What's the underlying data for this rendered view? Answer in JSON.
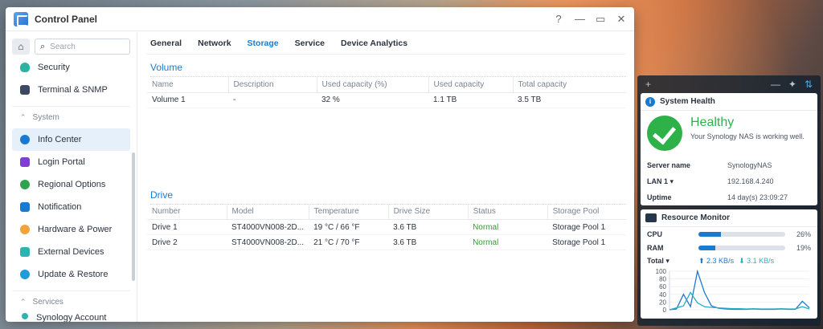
{
  "window": {
    "title": "Control Panel",
    "controls": [
      "?",
      "—",
      "▭",
      "✕"
    ]
  },
  "sidebar": {
    "search_placeholder": "Search",
    "items_top": [
      {
        "label": "Security",
        "color": "#2bb3a1"
      },
      {
        "label": "Terminal & SNMP",
        "color": "#3b4a5e"
      }
    ],
    "section_system": "System",
    "items_system": [
      {
        "label": "Info Center",
        "color": "#1a7ad0",
        "active": true
      },
      {
        "label": "Login Portal",
        "color": "#7e3fd0"
      },
      {
        "label": "Regional Options",
        "color": "#2fa34f"
      },
      {
        "label": "Notification",
        "color": "#1a7ad0"
      },
      {
        "label": "Hardware & Power",
        "color": "#f2a33a"
      },
      {
        "label": "External Devices",
        "color": "#2fb3b0"
      },
      {
        "label": "Update & Restore",
        "color": "#1e9bd8"
      }
    ],
    "section_services": "Services",
    "cutoff_item": "Synology Account"
  },
  "tabs": [
    "General",
    "Network",
    "Storage",
    "Service",
    "Device Analytics"
  ],
  "active_tab": "Storage",
  "volume": {
    "title": "Volume",
    "headers": [
      "Name",
      "Description",
      "Used capacity (%)",
      "Used capacity",
      "Total capacity"
    ],
    "rows": [
      [
        "Volume 1",
        "-",
        "32 %",
        "1.1 TB",
        "3.5 TB"
      ]
    ]
  },
  "drive": {
    "title": "Drive",
    "headers": [
      "Number",
      "Model",
      "Temperature",
      "Drive Size",
      "Status",
      "Storage Pool"
    ],
    "rows": [
      [
        "Drive 1",
        "ST4000VN008-2D...",
        "19 °C / 66 °F",
        "3.6 TB",
        "Normal",
        "Storage Pool 1"
      ],
      [
        "Drive 2",
        "ST4000VN008-2D...",
        "21 °C / 70 °F",
        "3.6 TB",
        "Normal",
        "Storage Pool 1"
      ]
    ]
  },
  "system_health": {
    "title": "System Health",
    "status": "Healthy",
    "message": "Your Synology NAS is working well.",
    "fields": [
      {
        "k": "Server name",
        "v": "SynologyNAS"
      },
      {
        "k": "LAN 1 ▾",
        "v": "192.168.4.240"
      },
      {
        "k": "Uptime",
        "v": "14 day(s) 23:09:27"
      }
    ]
  },
  "resource_monitor": {
    "title": "Resource Monitor",
    "cpu": {
      "label": "CPU",
      "value": 26,
      "text": "26%"
    },
    "ram": {
      "label": "RAM",
      "value": 19,
      "text": "19%"
    },
    "total_label": "Total ▾",
    "upload": "2.3 KB/s",
    "download": "3.1 KB/s"
  },
  "chart_data": {
    "type": "line",
    "ylim": [
      0,
      100
    ],
    "yticks": [
      "100",
      "80",
      "60",
      "40",
      "20",
      "0"
    ],
    "series": [
      {
        "values": [
          0,
          2,
          40,
          8,
          100,
          45,
          10,
          4,
          2,
          1,
          1,
          1,
          2,
          1,
          1,
          1,
          2,
          1,
          1,
          22,
          5
        ],
        "color": "#1a7ad0"
      },
      {
        "values": [
          0,
          5,
          10,
          45,
          18,
          8,
          6,
          5,
          4,
          3,
          3,
          2,
          3,
          2,
          2,
          2,
          3,
          2,
          2,
          8,
          2
        ],
        "color": "#26b0c2"
      }
    ]
  }
}
